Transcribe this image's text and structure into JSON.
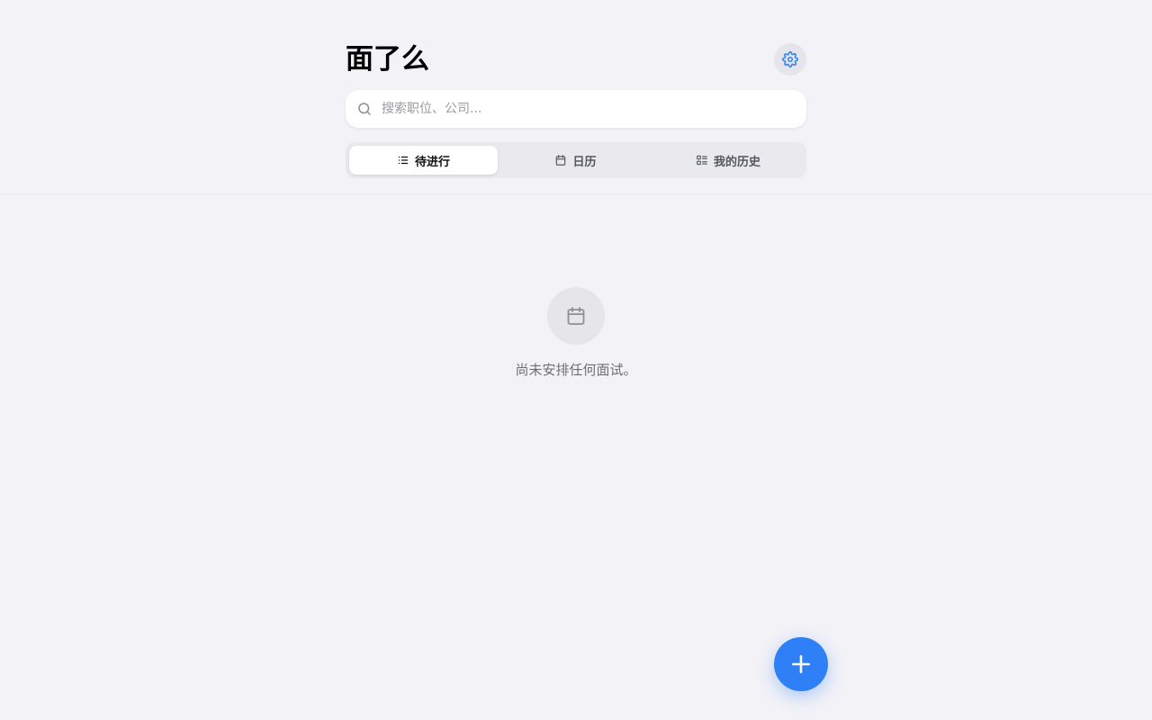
{
  "app": {
    "title": "面了么"
  },
  "search": {
    "placeholder": "搜索职位、公司...",
    "value": ""
  },
  "tabs": [
    {
      "label": "待进行",
      "icon": "list-icon",
      "active": true
    },
    {
      "label": "日历",
      "icon": "calendar-icon",
      "active": false
    },
    {
      "label": "我的历史",
      "icon": "history-list-icon",
      "active": false
    }
  ],
  "empty_state": {
    "icon": "calendar-icon",
    "message": "尚未安排任何面试。"
  },
  "fab": {
    "icon": "plus-icon"
  },
  "colors": {
    "accent": "#2f7ff6",
    "background": "#f2f2f7"
  }
}
